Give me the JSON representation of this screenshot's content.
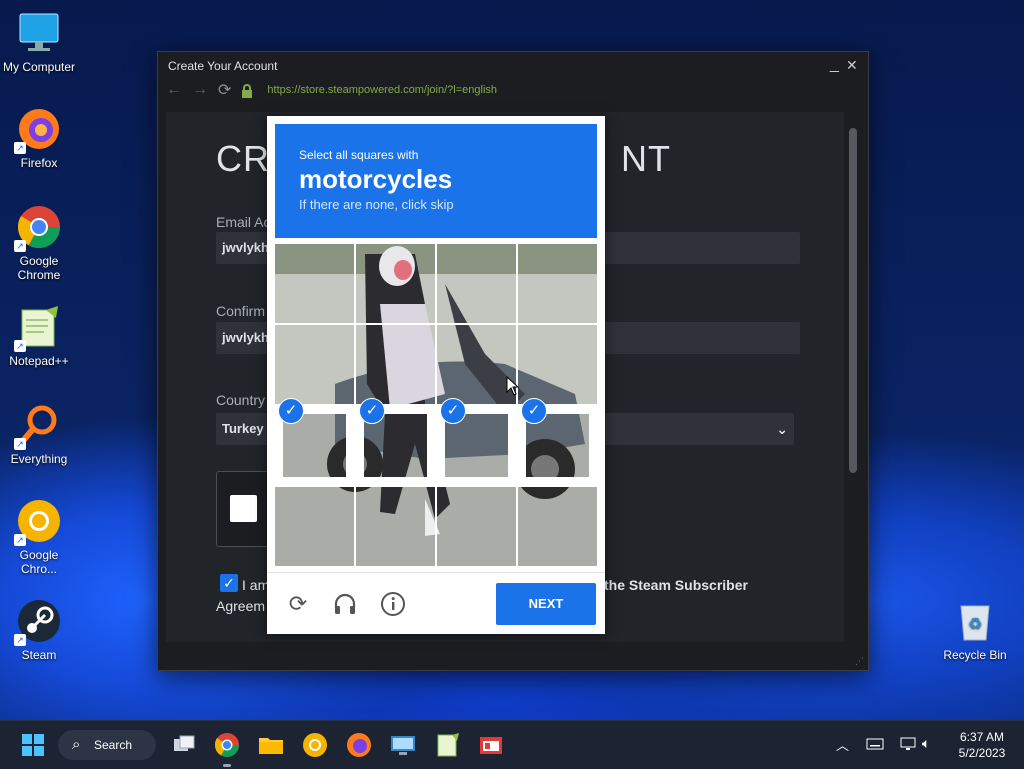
{
  "desktop": {
    "icons": [
      {
        "label": "My Computer"
      },
      {
        "label": "Firefox"
      },
      {
        "label": "Google Chrome"
      },
      {
        "label": "Notepad++"
      },
      {
        "label": "Everything"
      },
      {
        "label": "Google Chro..."
      },
      {
        "label": "Steam"
      },
      {
        "label": "Recycle Bin"
      }
    ]
  },
  "window": {
    "title": "Create Your Account",
    "minimize": "_",
    "close": "✕",
    "url": "https://store.steampowered.com/join/?l=english"
  },
  "page": {
    "heading_start": "CR",
    "heading_end": "NT",
    "email_label": "Email Ac",
    "email_value": "jwvlykh",
    "confirm_label": "Confirm",
    "confirm_value": "jwvlykh",
    "country_label": "Country",
    "country_value": "Turkey",
    "agree_start": "I am",
    "agree_link": "the Steam Subscriber",
    "agree_line2": "Agreem"
  },
  "captcha": {
    "instruction": "Select all squares with",
    "target": "motorcycles",
    "hint": "If there are none, click skip",
    "next_label": "NEXT",
    "tiles_selected": [
      false,
      false,
      false,
      false,
      false,
      false,
      false,
      false,
      true,
      true,
      true,
      true,
      false,
      false,
      false,
      false
    ]
  },
  "taskbar": {
    "search_label": "Search",
    "time": "6:37 AM",
    "date": "5/2/2023"
  },
  "colors": {
    "accent": "#1a73e8",
    "url_green": "#86a94a",
    "steam_bg": "#212429"
  }
}
